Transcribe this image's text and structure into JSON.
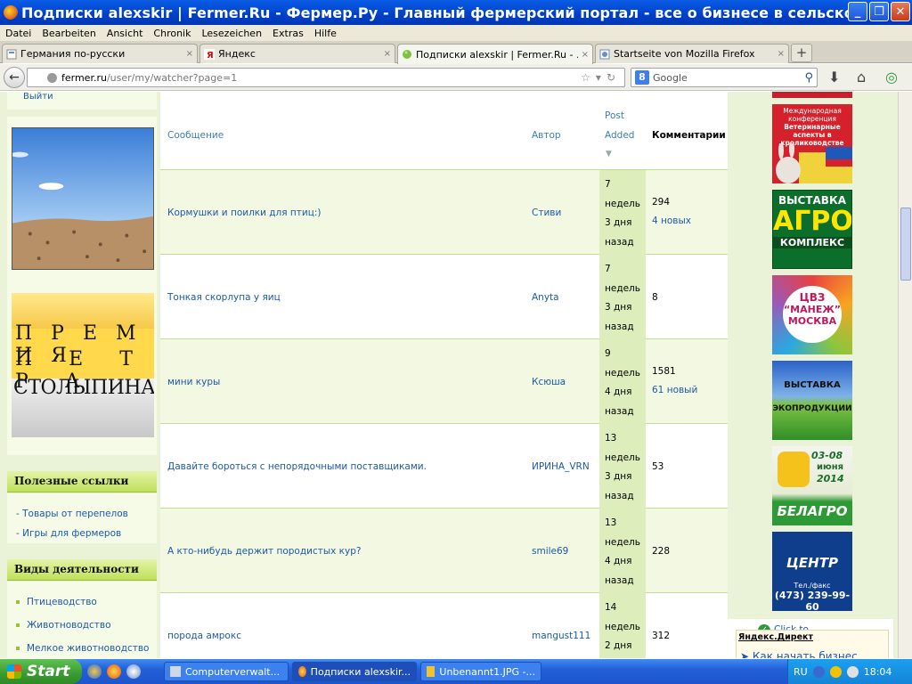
{
  "window": {
    "title": "Подписки alexskir | Fermer.Ru - Фермер.Ру - Главный фермерский портал - все о бизнесе в сельском хозяйст...",
    "min": "_",
    "max": "❐",
    "close": "✕"
  },
  "menu": [
    "Datei",
    "Bearbeiten",
    "Ansicht",
    "Chronik",
    "Lesezeichen",
    "Extras",
    "Hilfe"
  ],
  "tabs": [
    {
      "label": "Германия по-русски",
      "close": "×"
    },
    {
      "label": "Яндекс",
      "close": "×"
    },
    {
      "label": "Подписки alexskir | Fermer.Ru - ...",
      "close": "×"
    },
    {
      "label": "Startseite von Mozilla Firefox",
      "close": "×"
    }
  ],
  "newtab": "+",
  "nav": {
    "back": "←",
    "url_host": "fermer.ru",
    "url_path": "/user/my/watcher?page=1",
    "search_placeholder": "Google",
    "search_engine": "8"
  },
  "sidebar": {
    "exit": "Выйти",
    "premia": [
      "П Р Е М И Я",
      "П Е Т Р А",
      "СТОЛЫПИНА"
    ],
    "useful_title": "Полезные ссылки",
    "useful_links": [
      "- Товары от перепелов",
      "- Игры для фермеров"
    ],
    "activities_title": "Виды деятельности",
    "activities": [
      "Птицеводство",
      "Животноводство",
      "Мелкое животноводство"
    ]
  },
  "table": {
    "headers": {
      "message": "Сообщение",
      "author": "Автор",
      "post": "Post",
      "added": "Added",
      "comments": "Комментарии"
    },
    "rows": [
      {
        "message": "Кормушки и поилки для птиц:)",
        "author": "Стиви",
        "added": [
          "7",
          "недель",
          "3 дня",
          "назад"
        ],
        "comments": "294",
        "new": "4 новых"
      },
      {
        "message": "Тонкая скорлупа у яиц",
        "author": "Anyta",
        "added": [
          "7",
          "недель",
          "3 дня",
          "назад"
        ],
        "comments": "8",
        "new": ""
      },
      {
        "message": "мини куры",
        "author": "Ксюша",
        "added": [
          "9",
          "недель",
          "4 дня",
          "назад"
        ],
        "comments": "1581",
        "new": "61 новый"
      },
      {
        "message": "Давайте бороться с непорядочными поставщиками.",
        "author": "ИРИНА_VRN",
        "added": [
          "13",
          "недель",
          "3 дня",
          "назад"
        ],
        "comments": "53",
        "new": ""
      },
      {
        "message": "А кто-нибудь держит породистых кур?",
        "author": "smile69",
        "added": [
          "13",
          "недель",
          "4 дня",
          "назад"
        ],
        "comments": "228",
        "new": ""
      },
      {
        "message": "порода амрокс",
        "author": "mangust111",
        "added": [
          "14",
          "недель",
          "2 дня",
          ""
        ],
        "comments": "312",
        "new": ""
      }
    ]
  },
  "banners": {
    "b1": [
      "Международная",
      "конференция",
      "Ветеринарные",
      "аспекты в",
      "кролиководстве"
    ],
    "b2": [
      "ВЫСТАВКА",
      "АГРО",
      "КОМПЛЕКС"
    ],
    "b3": [
      "ЦВЗ",
      "“МАНЕЖ”",
      "МОСКВА"
    ],
    "b4": [
      "ВЫСТАВКА",
      "ЭКОПРОДУКЦИИ"
    ],
    "b5": [
      "03-08",
      "июня",
      "2014",
      "БЕЛАГРО"
    ],
    "b6": [
      "ЦЕНТР",
      "Тел./факс",
      "(473) 239-99-60"
    ]
  },
  "yandex_direct": {
    "clickto": "Click to",
    "title": "Яндекс.Директ",
    "teaser": "Как начать бизнес"
  },
  "taskbar": {
    "start": "Start",
    "tasks": [
      "Computerverwalt...",
      "Подписки alexskir...",
      "Unbenannt1.JPG -..."
    ],
    "lang": "RU",
    "time": "18:04"
  }
}
